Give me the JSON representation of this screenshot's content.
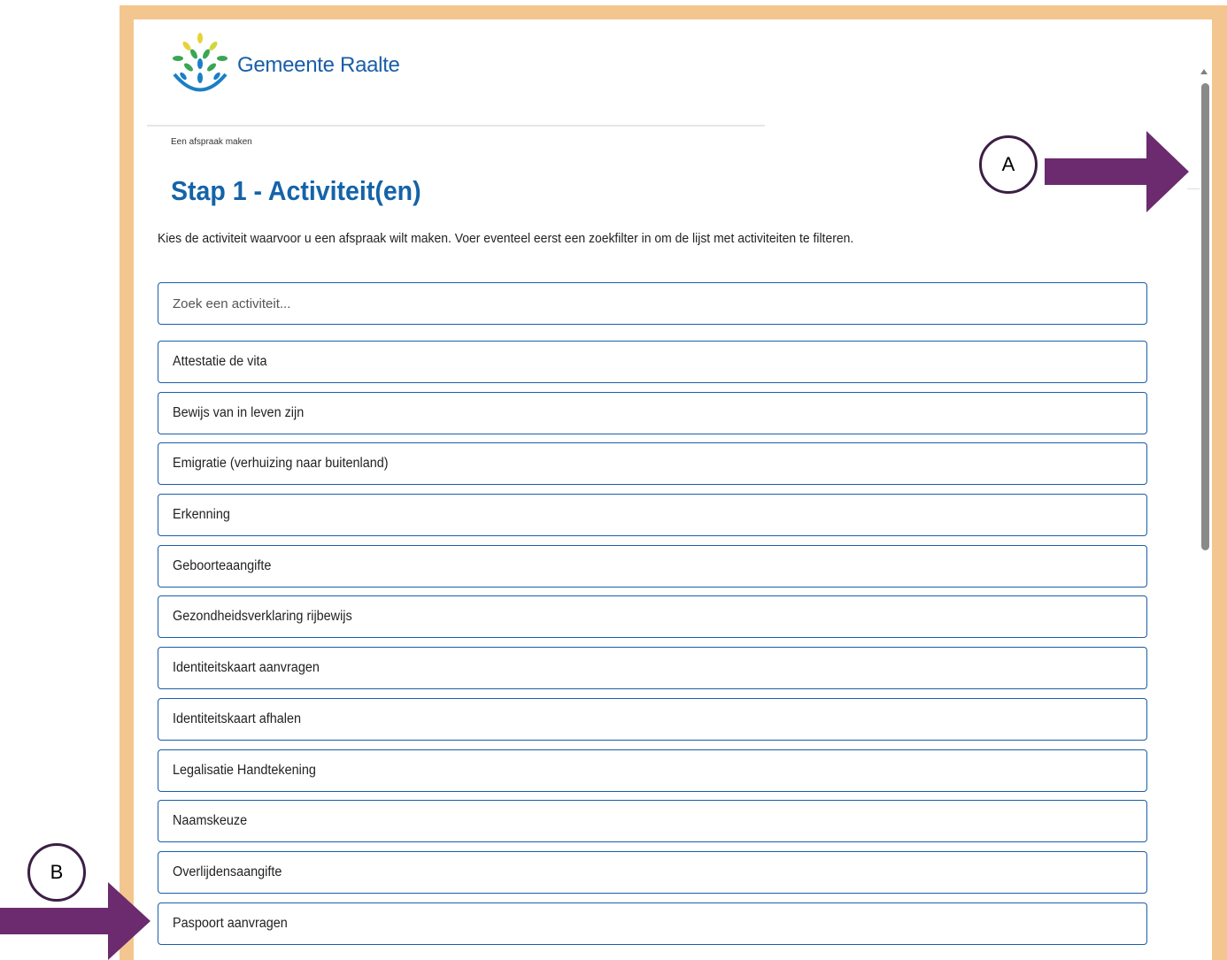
{
  "brand": {
    "name": "Gemeente Raalte"
  },
  "breadcrumb": "Een afspraak maken",
  "page_title": "Stap 1 - Activiteit(en)",
  "intro": "Kies de activiteit waarvoor u een afspraak wilt maken. Voer eventeel eerst een zoekfilter in om de lijst met activiteiten te filteren.",
  "search": {
    "placeholder": "Zoek een activiteit..."
  },
  "activities": [
    "Attestatie de vita",
    "Bewijs van in leven zijn",
    "Emigratie (verhuizing naar buitenland)",
    "Erkenning",
    "Geboorteaangifte",
    "Gezondheidsverklaring rijbewijs",
    "Identiteitskaart aanvragen",
    "Identiteitskaart afhalen",
    "Legalisatie Handtekening",
    "Naamskeuze",
    "Overlijdensaangifte",
    "Paspoort aanvragen"
  ],
  "annotations": {
    "a": "A",
    "b": "B"
  },
  "colors": {
    "frame": "#f4c68f",
    "primary": "#1a5ea8",
    "arrow": "#6b2b6e",
    "logo_green": "#3aa655",
    "logo_yellow": "#e8d23a",
    "logo_blue": "#1a7fc4"
  },
  "icons": [
    "gemeente-raalte-logo",
    "scroll-up-icon",
    "arrow-right-icon"
  ]
}
